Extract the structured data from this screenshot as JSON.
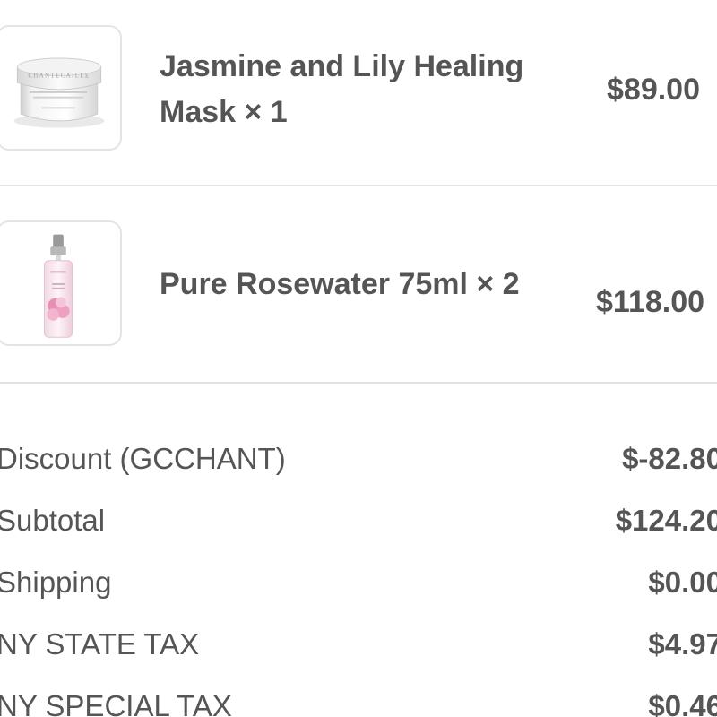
{
  "items": [
    {
      "title": "Jasmine and Lily Healing\nMask × 1",
      "price": "$89.00",
      "image_icon": "product-jar-icon",
      "jar_brand": "CHANTECAILLE"
    },
    {
      "title": "Pure Rosewater 75ml × 2",
      "price": "$118.00",
      "image_icon": "product-spray-bottle-icon"
    }
  ],
  "summary": {
    "discount": {
      "label": "Discount (GCCHANT)",
      "value": "$-82.80"
    },
    "subtotal": {
      "label": "Subtotal",
      "value": "$124.20"
    },
    "shipping": {
      "label": "Shipping",
      "value": "$0.00"
    },
    "state_tax": {
      "label": "NY STATE TAX",
      "value": "$4.97"
    },
    "special_tax": {
      "label": "NY SPECIAL TAX",
      "value": "$0.46"
    }
  },
  "colors": {
    "text": "#555555",
    "divider": "#e2e2e2",
    "thumb_border": "#e4e4e4",
    "rose_pink": "#f0b8cf"
  }
}
